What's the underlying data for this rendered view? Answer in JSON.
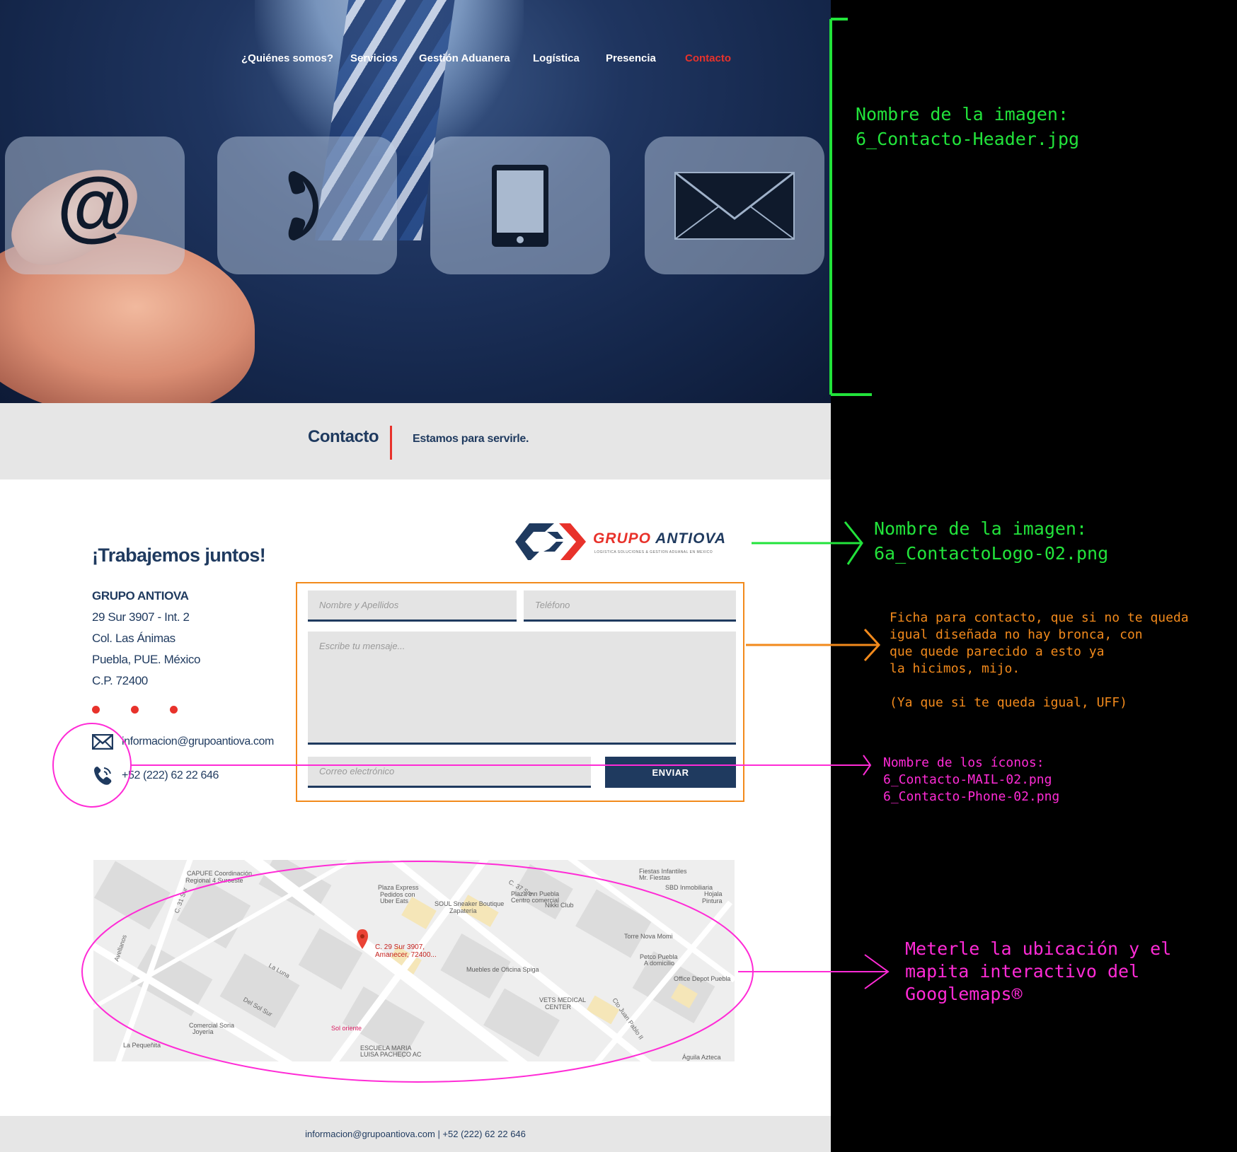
{
  "nav": {
    "items": [
      "¿Quiénes somos?",
      "Servicios",
      "Gestión Aduanera",
      "Logística",
      "Presencia",
      "Contacto"
    ],
    "active": "Contacto"
  },
  "section_bar": {
    "title": "Contacto",
    "subtitle": "Estamos para servirle."
  },
  "contact": {
    "heading": "¡Trabajemos juntos!",
    "address_lines": [
      "GRUPO ANTIOVA",
      "29 Sur 3907 - Int. 2",
      "Col. Las Ánimas",
      "Puebla, PUE. México",
      "C.P. 72400"
    ],
    "email": "informacion@grupoantiova.com",
    "phone": "+52 (222) 62 22 646"
  },
  "logo": {
    "word1": "GRUPO",
    "word2": "ANTIOVA",
    "tagline": "LOGISTICA SOLUCIONES & GESTION ADUANAL EN MEXICO"
  },
  "form": {
    "name_placeholder": "Nombre y Apellidos",
    "phone_placeholder": "Teléfono",
    "message_placeholder": "Escribe tu mensaje...",
    "email_placeholder": "Correo electrónico",
    "submit_label": "ENVIAR"
  },
  "map": {
    "pin_label_1": "C. 29 Sur 3907,",
    "pin_label_2": "Amanecer, 72400...",
    "places": [
      "CAPUFE Coordinación",
      "Regional 4 Suroeste",
      "Plaza Express",
      "Pedidos con",
      "Uber Eats",
      "SOUL Sneaker Boutique",
      "Zapatería",
      "Plaza Inn Puebla",
      "Centro comercial",
      "Nikki Club",
      "Fiestas Infantiles",
      "Mr. Fiestas",
      "SBD Inmobiliaria",
      "Hojala",
      "Pintura",
      "Torre Nova Momi",
      "Petco Puebla",
      "A domicilio",
      "Office Depot Puebla",
      "Muebles de Oficina Spiga",
      "VETS MEDICAL",
      "CENTER",
      "Comercial Soria",
      "Joyería",
      "Sol oriente",
      "La Pequeñita",
      "ESCUELA MARIA",
      "LUISA PACHECO AC",
      "Águila Azteca"
    ],
    "streets": [
      "C. 31 Sur",
      "La Luna",
      "Del Sol Sur",
      "Avellanos",
      "Cto Juan Pablo II",
      "C. 37 Sur"
    ]
  },
  "footer": {
    "text": "informacion@grupoantiova.com | +52 (222) 62 22 646"
  },
  "annotations": {
    "header_image": "Nombre de la imagen:\n6_Contacto-Header.jpg",
    "logo_image": "Nombre de la imagen:\n6a_ContactoLogo-02.png",
    "form_note": "Ficha para contacto, que si no te queda\nigual diseñada no hay bronca, con\nque quede parecido a esto ya\nla hicimos, mijo.\n\n(Ya que si te queda igual, UFF)",
    "icons_note": "Nombre de los íconos:\n6_Contacto-MAIL-02.png\n6_Contacto-Phone-02.png",
    "map_note": "Meterle la ubicación y el\nmapita interactivo del\nGooglemaps®"
  },
  "colors": {
    "navy": "#1f3a5f",
    "red": "#e8322b",
    "annotation_green": "#22e33b",
    "annotation_orange": "#f28a1c",
    "annotation_pink": "#ff2bd6"
  }
}
